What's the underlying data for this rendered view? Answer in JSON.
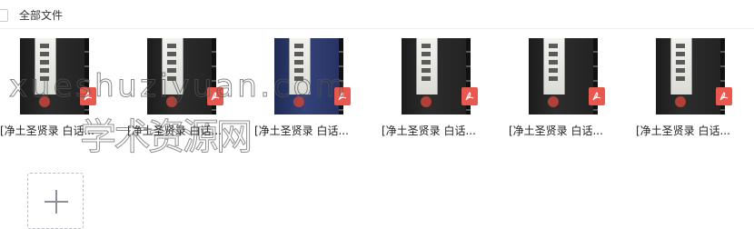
{
  "toolbar": {
    "select_all_icon": "checkbox-icon",
    "title": "全部文件"
  },
  "files": [
    {
      "name": "[净土圣贤录 白话...",
      "type_icon": "pdf-icon",
      "cover": "dark"
    },
    {
      "name": "[净土圣贤录 白话...",
      "type_icon": "pdf-icon",
      "cover": "dark"
    },
    {
      "name": "[净土圣贤录 白话...",
      "type_icon": "pdf-icon",
      "cover": "blue"
    },
    {
      "name": "[净土圣贤录 白话...",
      "type_icon": "pdf-icon",
      "cover": "dark"
    },
    {
      "name": "[净土圣贤录 白话...",
      "type_icon": "pdf-icon",
      "cover": "dark"
    },
    {
      "name": "[净土圣贤录 白话...",
      "type_icon": "pdf-icon",
      "cover": "dark"
    }
  ],
  "add_tile": {
    "icon": "plus-icon"
  },
  "watermark": {
    "line1": "xueshuziyuan.com",
    "line2": "学术资源网"
  },
  "colors": {
    "pdf_badge": "#e8584f",
    "seal": "#c7453a",
    "blue_cover": "#2a3668"
  }
}
